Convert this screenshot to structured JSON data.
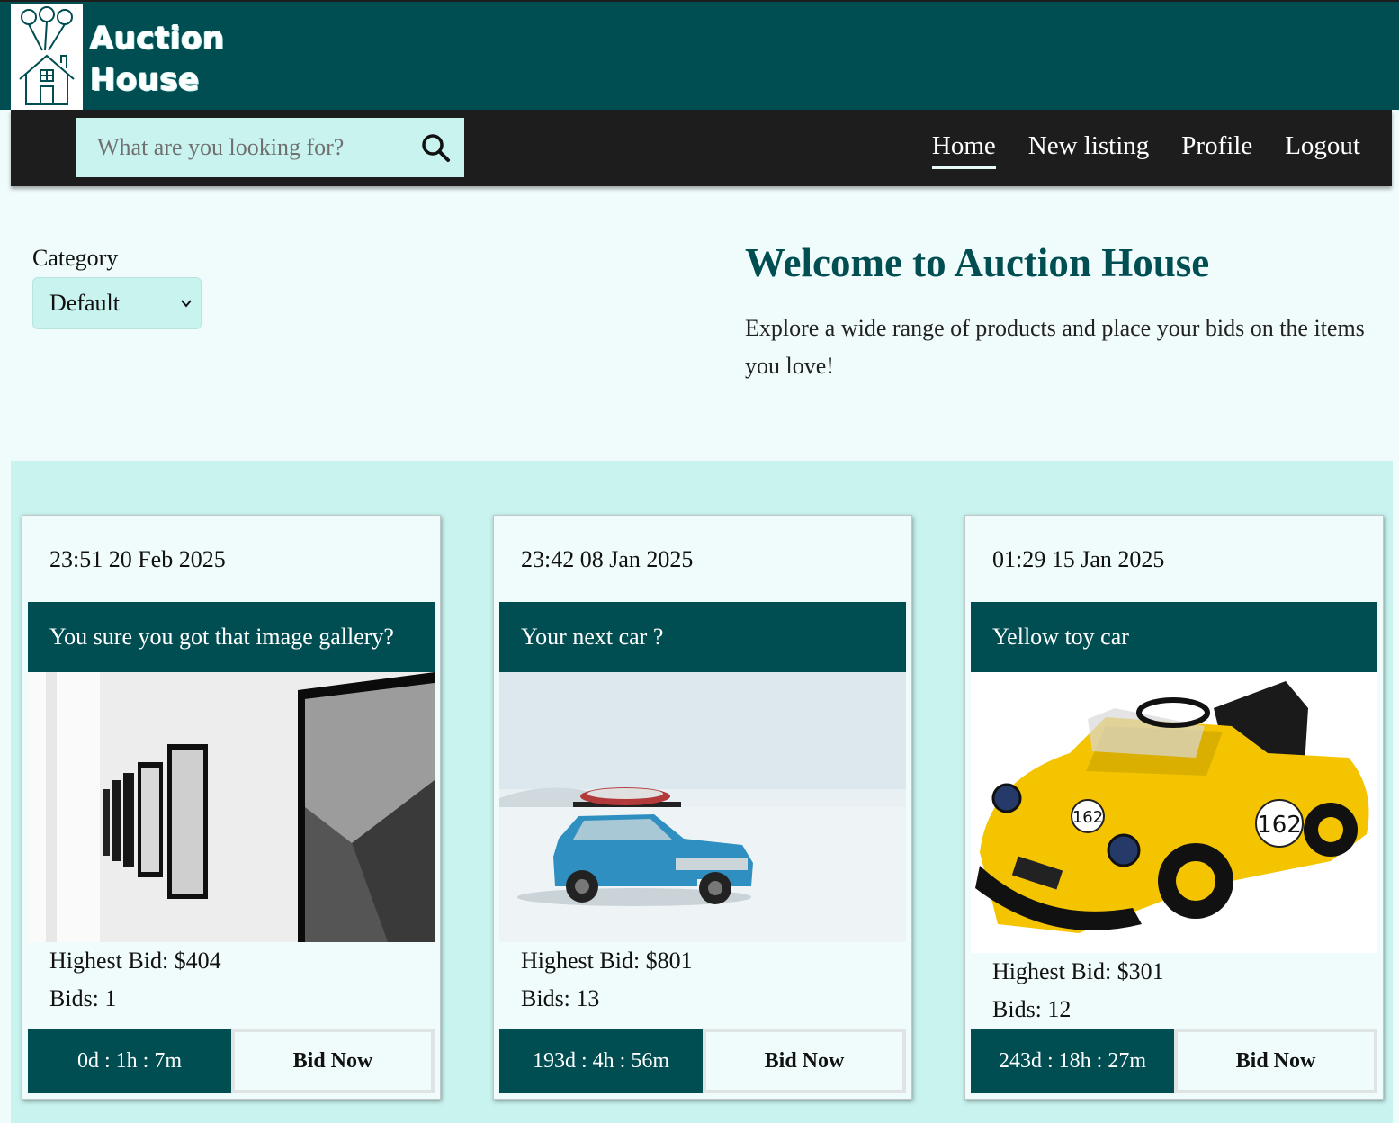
{
  "header": {
    "brand_line1": "Auction",
    "brand_line2": "House",
    "search_placeholder": "What are you looking for?",
    "nav": [
      {
        "label": "Home",
        "active": true
      },
      {
        "label": "New listing"
      },
      {
        "label": "Profile"
      },
      {
        "label": "Logout"
      }
    ]
  },
  "filters": {
    "category_label": "Category",
    "category_value": "Default"
  },
  "intro": {
    "title": "Welcome to Auction House",
    "text": "Explore a wide range of products and place your bids on the items you love!"
  },
  "listings": [
    {
      "date": "23:51 20 Feb 2025",
      "title": "You sure you got that image gallery?",
      "highest_bid": "Highest Bid: $404",
      "bids": "Bids: 1",
      "timer": "0d : 1h : 7m",
      "button": "Bid Now",
      "image": "gallery-photo"
    },
    {
      "date": "23:42 08 Jan 2025",
      "title": "Your next car ?",
      "highest_bid": "Highest Bid: $801",
      "bids": "Bids: 13",
      "timer": "193d : 4h : 56m",
      "button": "Bid Now",
      "image": "blue-car-snow-photo"
    },
    {
      "date": "01:29 15 Jan 2025",
      "title": "Yellow toy car",
      "highest_bid": "Highest Bid: $301",
      "bids": "Bids: 12",
      "timer": "243d : 18h : 27m",
      "button": "Bid Now",
      "image": "yellow-toy-car-photo"
    }
  ],
  "colors": {
    "primary": "#004d52",
    "accent_light": "#c9f3ef",
    "page_bg": "#f0fcfb",
    "nav_bg": "#1d1d1d"
  }
}
